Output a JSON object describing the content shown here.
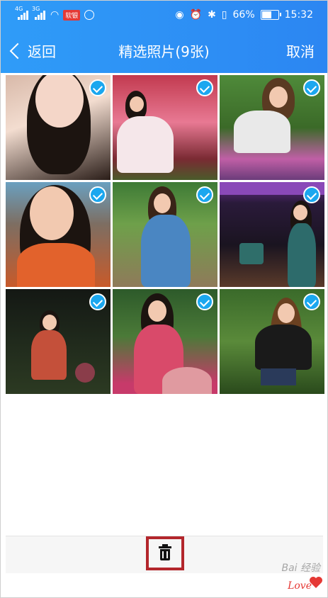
{
  "status_bar": {
    "network_1": "4G",
    "network_2": "3G",
    "app_badge": "软银",
    "battery": "66%",
    "battery_level": 0.66,
    "time": "15:32"
  },
  "nav": {
    "back_label": "返回",
    "title": "精选照片(9张)",
    "cancel_label": "取消"
  },
  "photos": [
    {
      "selected": true
    },
    {
      "selected": true
    },
    {
      "selected": true
    },
    {
      "selected": true
    },
    {
      "selected": true
    },
    {
      "selected": true
    },
    {
      "selected": true
    },
    {
      "selected": true
    },
    {
      "selected": true
    }
  ],
  "toolbar": {
    "delete_icon": "trash-icon"
  },
  "watermark": {
    "text": "Bai 经验",
    "love": "Love"
  },
  "colors": {
    "header": "#2c8ff5",
    "check": "#1ba7ef",
    "highlight": "#b3262c"
  }
}
